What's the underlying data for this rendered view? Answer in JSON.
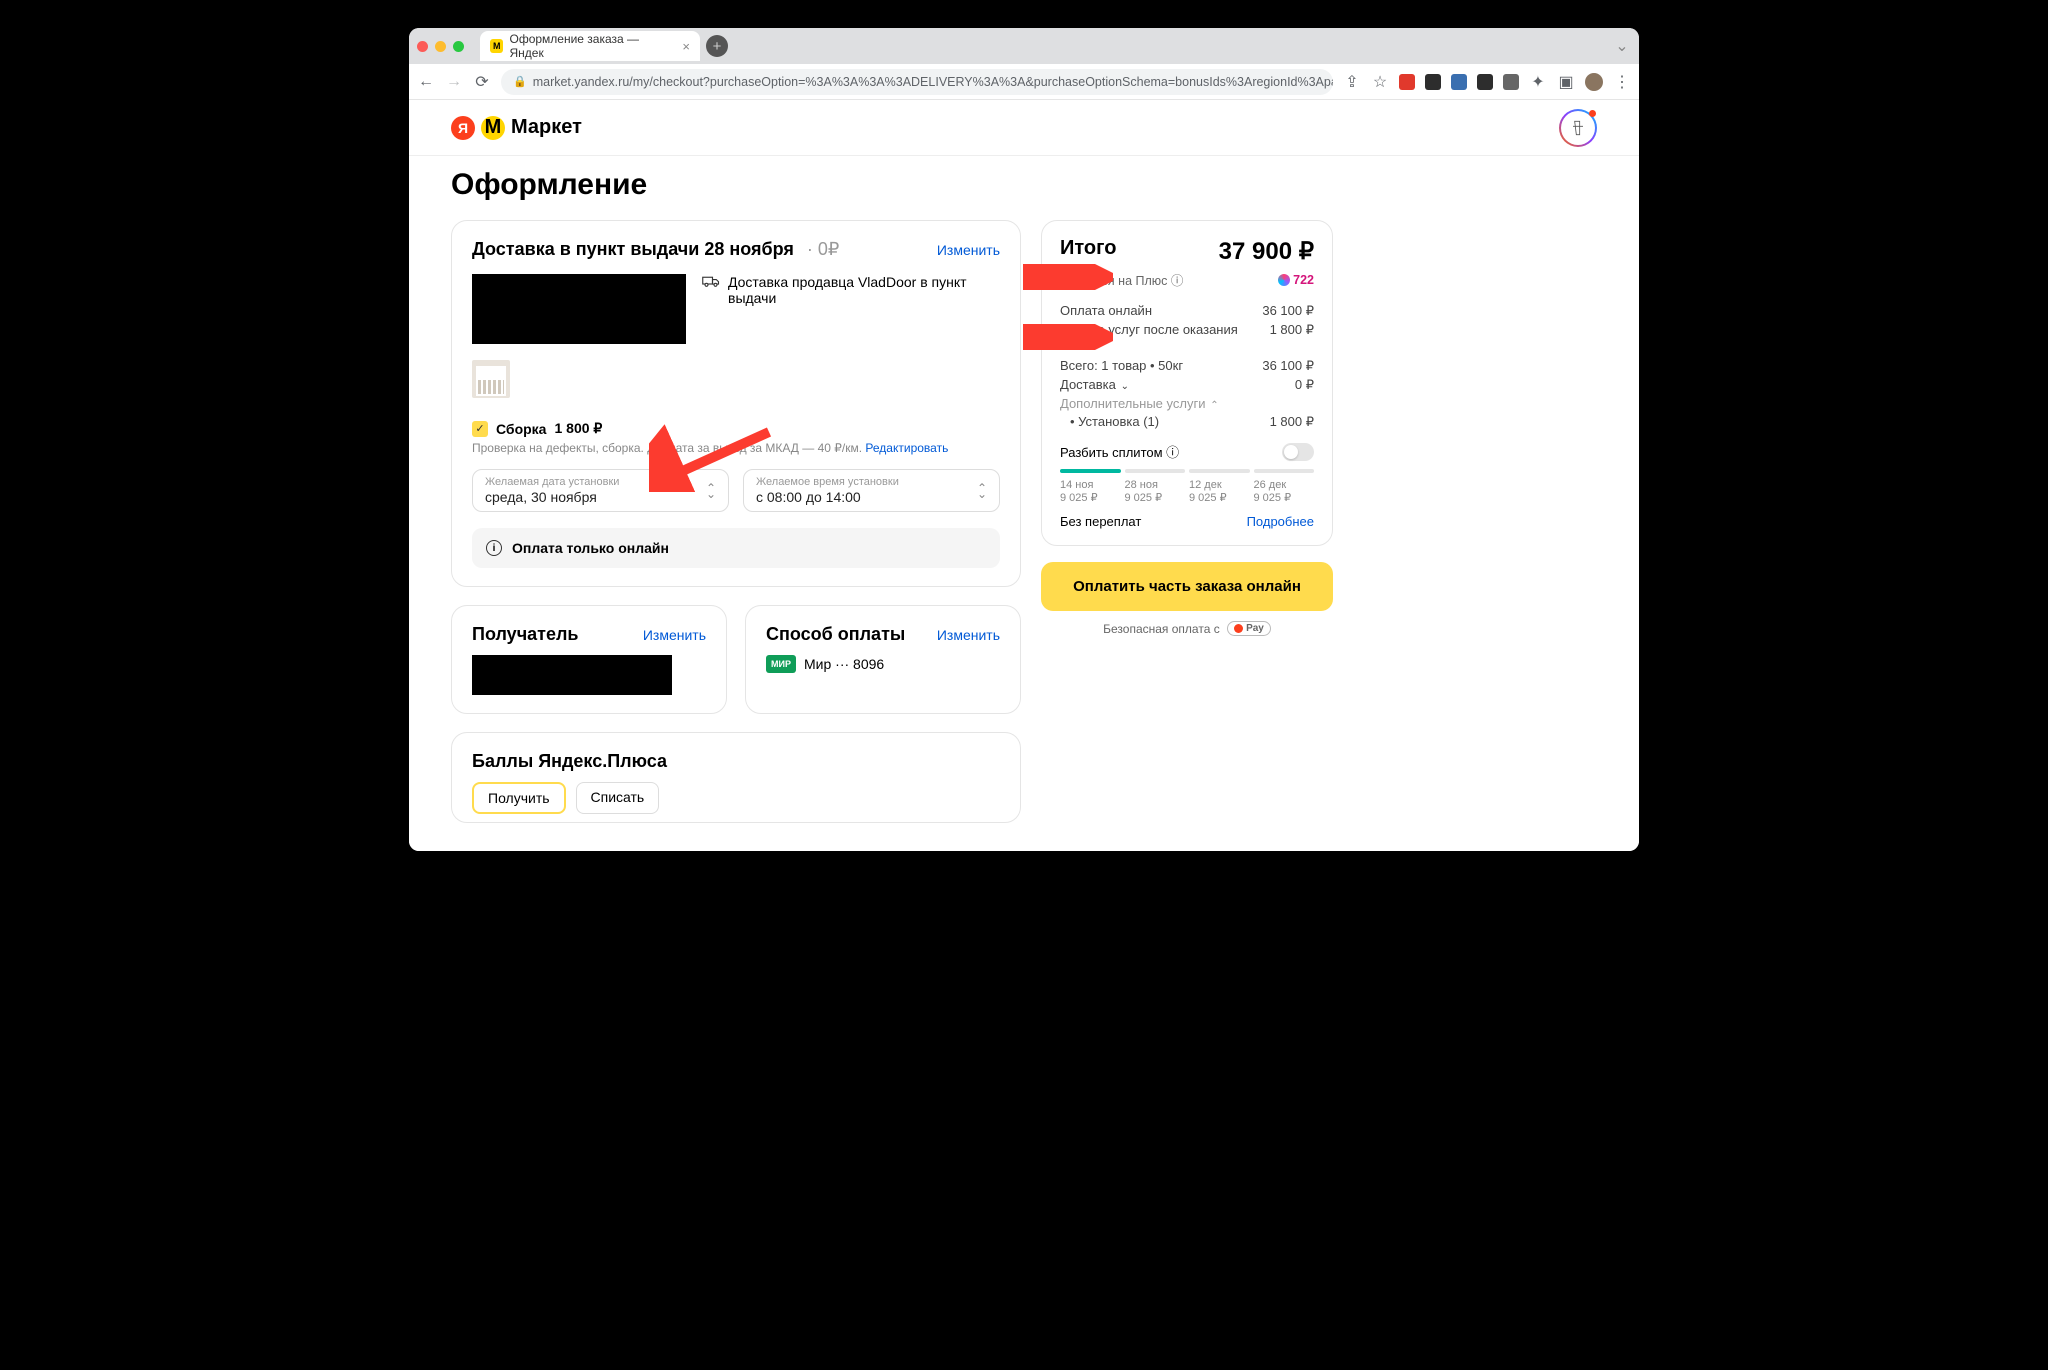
{
  "browser": {
    "tab_title": "Оформление заказа — Яндек",
    "url": "market.yandex.ru/my/checkout?purchaseOption=%3A%3A%3A%3ADELIVERY%3A%3A&purchaseOptionSchema=bonusIds%3AregionId%3ApaymentType%3Apayme..."
  },
  "header": {
    "brand": "Маркет"
  },
  "page_title": "Оформление",
  "delivery": {
    "title": "Доставка в пункт выдачи 28 ноября",
    "price_badge": "0₽",
    "change": "Изменить",
    "ship_text": "Доставка продавца VladDoor в пункт выдачи"
  },
  "assembly": {
    "label": "Сборка",
    "price": "1 800 ₽",
    "desc": "Проверка на дефекты, сборка. Доплата за выезд за МКАД — 40 ₽/км.",
    "edit": "Редактировать",
    "date_label": "Желаемая дата установки",
    "date_value": "среда, 30 ноября",
    "time_label": "Желаемое время установки",
    "time_value": "с 08:00 до 14:00",
    "notice": "Оплата только онлайн"
  },
  "recipient": {
    "title": "Получатель",
    "change": "Изменить"
  },
  "payment": {
    "title": "Способ оплаты",
    "change": "Изменить",
    "method": "Мир ··· 8096",
    "mir": "МИР"
  },
  "plus": {
    "title": "Баллы Яндекс.Плюса",
    "tab_get": "Получить",
    "tab_spend": "Списать"
  },
  "summary": {
    "title": "Итого",
    "total": "37 900",
    "cashback_label": "Вернётся на Плюс",
    "cashback": "722",
    "online_label": "Оплата онлайн",
    "online_value": "36 100 ₽",
    "service_label": "Оплата услуг после оказания",
    "service_value": "1 800 ₽",
    "items_label": "Всего: 1 товар • 50кг",
    "items_value": "36 100 ₽",
    "delivery_label": "Доставка",
    "delivery_value": "0 ₽",
    "extra_label": "Дополнительные услуги",
    "install_label": "Установка (1)",
    "install_value": "1 800 ₽",
    "split_label": "Разбить сплитом",
    "segments": [
      {
        "date": "14 ноя",
        "amt": "9 025 ₽"
      },
      {
        "date": "28 ноя",
        "amt": "9 025 ₽"
      },
      {
        "date": "12 дек",
        "amt": "9 025 ₽"
      },
      {
        "date": "26 дек",
        "amt": "9 025 ₽"
      }
    ],
    "nofee": "Без переплат",
    "more": "Подробнее",
    "pay_button": "Оплатить часть заказа онлайн",
    "secure": "Безопасная оплата с",
    "pay_badge": "Pay"
  },
  "info_icon": "ⓘ"
}
